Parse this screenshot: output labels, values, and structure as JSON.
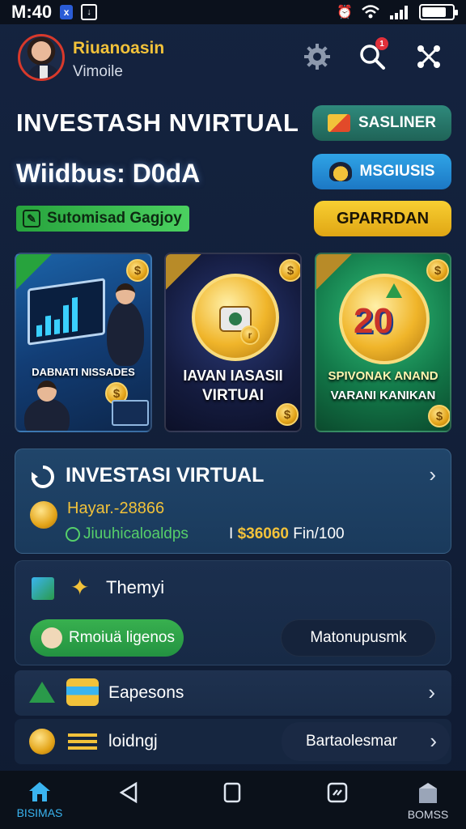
{
  "status_bar": {
    "time": "M:40",
    "battery_level": 0.8
  },
  "header": {
    "username": "Riuanoasin",
    "subtitle": "Vimoile",
    "notification_count": "1"
  },
  "hero": {
    "title_1": "INVESTASH NVIRTUAL",
    "title_2": "Wiidbus: D0dA",
    "promo_label": "Sutomisad Gagjoy"
  },
  "actions": {
    "saslines": "SASLINER",
    "msgiusis": "MSGIUSIS",
    "gparrdan": "GPARRDAN"
  },
  "cards": [
    {
      "caption": "DABNATI NISSADES"
    },
    {
      "caption_1": "IAVAN IASASII",
      "caption_2": "VIRTUAI",
      "coin_text": "r"
    },
    {
      "caption_1": "SPIVONAK ANAND",
      "caption_2": "VARANI KANIKAN",
      "art_text": "20"
    }
  ],
  "invest": {
    "title": "INVESTASI VIRTUAL",
    "amount": "Hayar.-28866",
    "description": "Jiuuhicaloaldps",
    "value_prefix": "I",
    "value": "$36060",
    "value_suffix": "Fin/100"
  },
  "theme": {
    "title": "Themyi",
    "green_button": "Rmoiuä ligenos",
    "dark_button": "Matonupusmk"
  },
  "rows": {
    "expenses": "Eapesons",
    "loading": "loidngj",
    "button": "Bartaolesmar"
  },
  "nav": {
    "home": "BISIMAS",
    "right": "BOMSS"
  },
  "colors": {
    "accent": "#3ab4f0",
    "gold": "#f2c23a",
    "green": "#39b04f"
  }
}
